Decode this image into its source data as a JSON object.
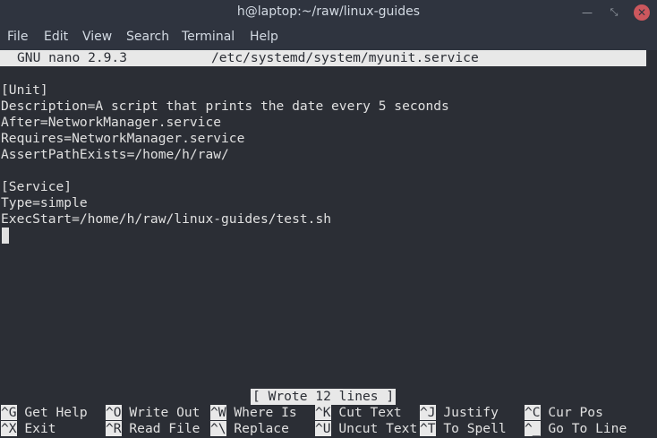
{
  "window": {
    "title": "h@laptop:~/raw/linux-guides",
    "minimize_glyph": "—",
    "maximize_glyph": "⤡",
    "close_glyph": "✕"
  },
  "menu": [
    "File",
    "Edit",
    "View",
    "Search",
    "Terminal",
    "Help"
  ],
  "nano": {
    "version": "GNU nano 2.9.3",
    "filename": "/etc/systemd/system/myunit.service",
    "lines": [
      "",
      "[Unit]",
      "Description=A script that prints the date every 5 seconds",
      "After=NetworkManager.service",
      "Requires=NetworkManager.service",
      "AssertPathExists=/home/h/raw/",
      "",
      "[Service]",
      "Type=simple",
      "ExecStart=/home/h/raw/linux-guides/test.sh"
    ],
    "status_message": "[ Wrote 12 lines ]",
    "shortcuts_row1": [
      {
        "key": "^G",
        "label": "Get Help"
      },
      {
        "key": "^O",
        "label": "Write Out"
      },
      {
        "key": "^W",
        "label": "Where Is"
      },
      {
        "key": "^K",
        "label": "Cut Text"
      },
      {
        "key": "^J",
        "label": "Justify"
      },
      {
        "key": "^C",
        "label": "Cur Pos"
      }
    ],
    "shortcuts_row2": [
      {
        "key": "^X",
        "label": "Exit"
      },
      {
        "key": "^R",
        "label": "Read File"
      },
      {
        "key": "^\\",
        "label": "Replace"
      },
      {
        "key": "^U",
        "label": "Uncut Text"
      },
      {
        "key": "^T",
        "label": "To Spell"
      },
      {
        "key": "^_",
        "label": "Go To Line"
      }
    ]
  }
}
